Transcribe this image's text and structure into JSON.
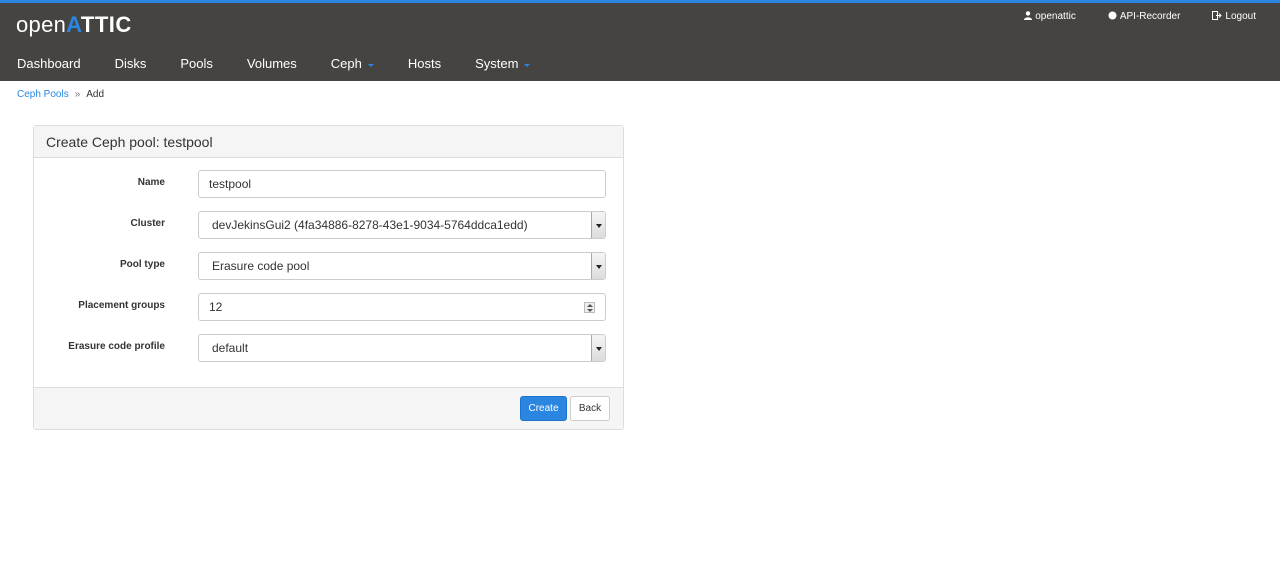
{
  "brand": {
    "part1": "open",
    "part2_mark": "A",
    "part2_rest": "TTIC"
  },
  "user_links": [
    {
      "label": "openattic",
      "icon": "user-icon"
    },
    {
      "label": "API-Recorder",
      "icon": "record-circle-icon"
    },
    {
      "label": "Logout",
      "icon": "logout-icon"
    }
  ],
  "nav": {
    "items": [
      {
        "label": "Dashboard"
      },
      {
        "label": "Disks"
      },
      {
        "label": "Pools"
      },
      {
        "label": "Volumes"
      },
      {
        "label": "Ceph",
        "dropdown": true
      },
      {
        "label": "Hosts"
      },
      {
        "label": "System",
        "dropdown": true
      }
    ]
  },
  "breadcrumb": {
    "parent": "Ceph Pools",
    "separator": "»",
    "current": "Add"
  },
  "form": {
    "title": "Create Ceph pool: testpool",
    "fields": {
      "name": {
        "label": "Name",
        "value": "testpool"
      },
      "cluster": {
        "label": "Cluster",
        "value": "devJekinsGui2 (4fa34886-8278-43e1-9034-5764ddca1edd)"
      },
      "pool_type": {
        "label": "Pool type",
        "value": "Erasure code pool"
      },
      "placement_groups": {
        "label": "Placement groups",
        "value": "12"
      },
      "erasure_code_profile": {
        "label": "Erasure code profile",
        "value": "default"
      }
    },
    "buttons": {
      "create": "Create",
      "back": "Back"
    }
  },
  "colors": {
    "accent": "#2a86e0",
    "topbar": "#454441"
  }
}
